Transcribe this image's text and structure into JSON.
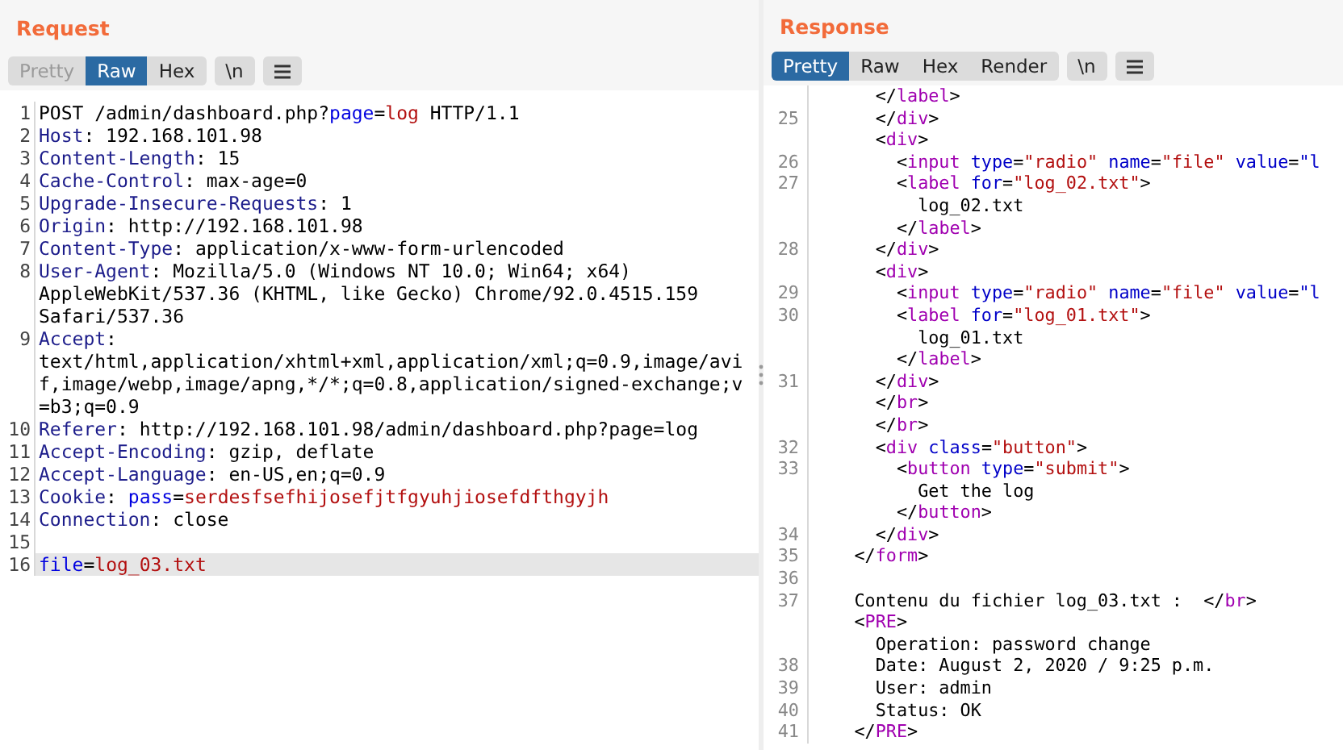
{
  "request": {
    "title": "Request",
    "tabs": [
      {
        "label": "Pretty",
        "selected": false,
        "disabled": true
      },
      {
        "label": "Raw",
        "selected": true,
        "disabled": false
      },
      {
        "label": "Hex",
        "selected": false,
        "disabled": false
      }
    ],
    "newline_button": "\\n",
    "lines": [
      {
        "number": "1",
        "highlighted": false,
        "rows": [
          [
            {
              "kind": "text",
              "text": "POST /admin/dashboard.php?"
            },
            {
              "kind": "param",
              "text": "page"
            },
            {
              "kind": "text",
              "text": "="
            },
            {
              "kind": "value",
              "text": "log"
            },
            {
              "kind": "text",
              "text": " HTTP/1.1"
            }
          ]
        ]
      },
      {
        "number": "2",
        "highlighted": false,
        "rows": [
          [
            {
              "kind": "key",
              "text": "Host"
            },
            {
              "kind": "text",
              "text": ": 192.168.101.98"
            }
          ]
        ]
      },
      {
        "number": "3",
        "highlighted": false,
        "rows": [
          [
            {
              "kind": "key",
              "text": "Content-Length"
            },
            {
              "kind": "text",
              "text": ": 15"
            }
          ]
        ]
      },
      {
        "number": "4",
        "highlighted": false,
        "rows": [
          [
            {
              "kind": "key",
              "text": "Cache-Control"
            },
            {
              "kind": "text",
              "text": ": max-age=0"
            }
          ]
        ]
      },
      {
        "number": "5",
        "highlighted": false,
        "rows": [
          [
            {
              "kind": "key",
              "text": "Upgrade-Insecure-Requests"
            },
            {
              "kind": "text",
              "text": ": 1"
            }
          ]
        ]
      },
      {
        "number": "6",
        "highlighted": false,
        "rows": [
          [
            {
              "kind": "key",
              "text": "Origin"
            },
            {
              "kind": "text",
              "text": ": http://192.168.101.98"
            }
          ]
        ]
      },
      {
        "number": "7",
        "highlighted": false,
        "rows": [
          [
            {
              "kind": "key",
              "text": "Content-Type"
            },
            {
              "kind": "text",
              "text": ": application/x-www-form-urlencoded"
            }
          ]
        ]
      },
      {
        "number": "8",
        "highlighted": false,
        "rows": [
          [
            {
              "kind": "key",
              "text": "User-Agent"
            },
            {
              "kind": "text",
              "text": ": Mozilla/5.0 (Windows NT 10.0; Win64; x64)"
            }
          ],
          [
            {
              "kind": "text",
              "text": "AppleWebKit/537.36 (KHTML, like Gecko) Chrome/92.0.4515.159"
            }
          ],
          [
            {
              "kind": "text",
              "text": "Safari/537.36"
            }
          ]
        ]
      },
      {
        "number": "9",
        "highlighted": false,
        "rows": [
          [
            {
              "kind": "key",
              "text": "Accept"
            },
            {
              "kind": "text",
              "text": ":"
            }
          ],
          [
            {
              "kind": "text",
              "text": "text/html,application/xhtml+xml,application/xml;q=0.9,image/avi"
            }
          ],
          [
            {
              "kind": "text",
              "text": "f,image/webp,image/apng,*/*;q=0.8,application/signed-exchange;v"
            }
          ],
          [
            {
              "kind": "text",
              "text": "=b3;q=0.9"
            }
          ]
        ]
      },
      {
        "number": "10",
        "highlighted": false,
        "rows": [
          [
            {
              "kind": "key",
              "text": "Referer"
            },
            {
              "kind": "text",
              "text": ": http://192.168.101.98/admin/dashboard.php?page=log"
            }
          ]
        ]
      },
      {
        "number": "11",
        "highlighted": false,
        "rows": [
          [
            {
              "kind": "key",
              "text": "Accept-Encoding"
            },
            {
              "kind": "text",
              "text": ": gzip, deflate"
            }
          ]
        ]
      },
      {
        "number": "12",
        "highlighted": false,
        "rows": [
          [
            {
              "kind": "key",
              "text": "Accept-Language"
            },
            {
              "kind": "text",
              "text": ": en-US,en;q=0.9"
            }
          ]
        ]
      },
      {
        "number": "13",
        "highlighted": false,
        "rows": [
          [
            {
              "kind": "key",
              "text": "Cookie"
            },
            {
              "kind": "text",
              "text": ": "
            },
            {
              "kind": "param",
              "text": "pass"
            },
            {
              "kind": "text",
              "text": "="
            },
            {
              "kind": "value",
              "text": "serdesfsefhijosefjtfgyuhjiosefdfthgyjh"
            }
          ]
        ]
      },
      {
        "number": "14",
        "highlighted": false,
        "rows": [
          [
            {
              "kind": "key",
              "text": "Connection"
            },
            {
              "kind": "text",
              "text": ": close"
            }
          ]
        ]
      },
      {
        "number": "15",
        "highlighted": false,
        "rows": [
          []
        ]
      },
      {
        "number": "16",
        "highlighted": true,
        "rows": [
          [
            {
              "kind": "param",
              "text": "file"
            },
            {
              "kind": "text",
              "text": "="
            },
            {
              "kind": "value",
              "text": "log_03.txt"
            }
          ]
        ]
      }
    ]
  },
  "response": {
    "title": "Response",
    "tabs": [
      {
        "label": "Pretty",
        "selected": true,
        "disabled": false
      },
      {
        "label": "Raw",
        "selected": false,
        "disabled": false
      },
      {
        "label": "Hex",
        "selected": false,
        "disabled": false
      },
      {
        "label": "Render",
        "selected": false,
        "disabled": false
      }
    ],
    "newline_button": "\\n",
    "lines": [
      {
        "rows": [
          [
            {
              "kind": "text",
              "text": "      </"
            },
            {
              "kind": "tag",
              "text": "label"
            },
            {
              "kind": "text",
              "text": ">"
            }
          ]
        ]
      },
      {
        "number": "25",
        "rows": [
          [
            {
              "kind": "text",
              "text": "      </"
            },
            {
              "kind": "tag",
              "text": "div"
            },
            {
              "kind": "text",
              "text": ">"
            }
          ]
        ]
      },
      {
        "rows": [
          [
            {
              "kind": "text",
              "text": "      <"
            },
            {
              "kind": "tag",
              "text": "div"
            },
            {
              "kind": "text",
              "text": ">"
            }
          ]
        ]
      },
      {
        "number": "26",
        "rows": [
          [
            {
              "kind": "text",
              "text": "        <"
            },
            {
              "kind": "tag",
              "text": "input"
            },
            {
              "kind": "text",
              "text": " "
            },
            {
              "kind": "attr",
              "text": "type"
            },
            {
              "kind": "text",
              "text": "="
            },
            {
              "kind": "value",
              "text": "\"radio\""
            },
            {
              "kind": "text",
              "text": " "
            },
            {
              "kind": "attr",
              "text": "name"
            },
            {
              "kind": "text",
              "text": "="
            },
            {
              "kind": "value",
              "text": "\"file\""
            },
            {
              "kind": "text",
              "text": " "
            },
            {
              "kind": "attr",
              "text": "value"
            },
            {
              "kind": "text",
              "text": "="
            },
            {
              "kind": "attr",
              "text": "\"l"
            }
          ]
        ]
      },
      {
        "number": "27",
        "rows": [
          [
            {
              "kind": "text",
              "text": "        <"
            },
            {
              "kind": "tag",
              "text": "label"
            },
            {
              "kind": "text",
              "text": " "
            },
            {
              "kind": "attr",
              "text": "for"
            },
            {
              "kind": "text",
              "text": "="
            },
            {
              "kind": "value",
              "text": "\"log_02.txt\""
            },
            {
              "kind": "text",
              "text": ">"
            }
          ]
        ]
      },
      {
        "rows": [
          [
            {
              "kind": "text",
              "text": "          log_02.txt"
            }
          ]
        ]
      },
      {
        "rows": [
          [
            {
              "kind": "text",
              "text": "        </"
            },
            {
              "kind": "tag",
              "text": "label"
            },
            {
              "kind": "text",
              "text": ">"
            }
          ]
        ]
      },
      {
        "number": "28",
        "rows": [
          [
            {
              "kind": "text",
              "text": "      </"
            },
            {
              "kind": "tag",
              "text": "div"
            },
            {
              "kind": "text",
              "text": ">"
            }
          ]
        ]
      },
      {
        "rows": [
          [
            {
              "kind": "text",
              "text": "      <"
            },
            {
              "kind": "tag",
              "text": "div"
            },
            {
              "kind": "text",
              "text": ">"
            }
          ]
        ]
      },
      {
        "number": "29",
        "rows": [
          [
            {
              "kind": "text",
              "text": "        <"
            },
            {
              "kind": "tag",
              "text": "input"
            },
            {
              "kind": "text",
              "text": " "
            },
            {
              "kind": "attr",
              "text": "type"
            },
            {
              "kind": "text",
              "text": "="
            },
            {
              "kind": "value",
              "text": "\"radio\""
            },
            {
              "kind": "text",
              "text": " "
            },
            {
              "kind": "attr",
              "text": "name"
            },
            {
              "kind": "text",
              "text": "="
            },
            {
              "kind": "value",
              "text": "\"file\""
            },
            {
              "kind": "text",
              "text": " "
            },
            {
              "kind": "attr",
              "text": "value"
            },
            {
              "kind": "text",
              "text": "="
            },
            {
              "kind": "attr",
              "text": "\"l"
            }
          ]
        ]
      },
      {
        "number": "30",
        "rows": [
          [
            {
              "kind": "text",
              "text": "        <"
            },
            {
              "kind": "tag",
              "text": "label"
            },
            {
              "kind": "text",
              "text": " "
            },
            {
              "kind": "attr",
              "text": "for"
            },
            {
              "kind": "text",
              "text": "="
            },
            {
              "kind": "value",
              "text": "\"log_01.txt\""
            },
            {
              "kind": "text",
              "text": ">"
            }
          ]
        ]
      },
      {
        "rows": [
          [
            {
              "kind": "text",
              "text": "          log_01.txt"
            }
          ]
        ]
      },
      {
        "rows": [
          [
            {
              "kind": "text",
              "text": "        </"
            },
            {
              "kind": "tag",
              "text": "label"
            },
            {
              "kind": "text",
              "text": ">"
            }
          ]
        ]
      },
      {
        "number": "31",
        "rows": [
          [
            {
              "kind": "text",
              "text": "      </"
            },
            {
              "kind": "tag",
              "text": "div"
            },
            {
              "kind": "text",
              "text": ">"
            }
          ]
        ]
      },
      {
        "rows": [
          [
            {
              "kind": "text",
              "text": "      </"
            },
            {
              "kind": "tag",
              "text": "br"
            },
            {
              "kind": "text",
              "text": ">"
            }
          ]
        ]
      },
      {
        "rows": [
          [
            {
              "kind": "text",
              "text": "      </"
            },
            {
              "kind": "tag",
              "text": "br"
            },
            {
              "kind": "text",
              "text": ">"
            }
          ]
        ]
      },
      {
        "number": "32",
        "rows": [
          [
            {
              "kind": "text",
              "text": "      <"
            },
            {
              "kind": "tag",
              "text": "div"
            },
            {
              "kind": "text",
              "text": " "
            },
            {
              "kind": "attr",
              "text": "class"
            },
            {
              "kind": "text",
              "text": "="
            },
            {
              "kind": "value",
              "text": "\"button\""
            },
            {
              "kind": "text",
              "text": ">"
            }
          ]
        ]
      },
      {
        "number": "33",
        "rows": [
          [
            {
              "kind": "text",
              "text": "        <"
            },
            {
              "kind": "tag",
              "text": "button"
            },
            {
              "kind": "text",
              "text": " "
            },
            {
              "kind": "attr",
              "text": "type"
            },
            {
              "kind": "text",
              "text": "="
            },
            {
              "kind": "value",
              "text": "\"submit\""
            },
            {
              "kind": "text",
              "text": ">"
            }
          ]
        ]
      },
      {
        "rows": [
          [
            {
              "kind": "text",
              "text": "          Get the log"
            }
          ]
        ]
      },
      {
        "rows": [
          [
            {
              "kind": "text",
              "text": "        </"
            },
            {
              "kind": "tag",
              "text": "button"
            },
            {
              "kind": "text",
              "text": ">"
            }
          ]
        ]
      },
      {
        "number": "34",
        "rows": [
          [
            {
              "kind": "text",
              "text": "      </"
            },
            {
              "kind": "tag",
              "text": "div"
            },
            {
              "kind": "text",
              "text": ">"
            }
          ]
        ]
      },
      {
        "number": "35",
        "rows": [
          [
            {
              "kind": "text",
              "text": "    </"
            },
            {
              "kind": "tag",
              "text": "form"
            },
            {
              "kind": "text",
              "text": ">"
            }
          ]
        ]
      },
      {
        "number": "36",
        "rows": [
          []
        ]
      },
      {
        "number": "37",
        "rows": [
          [
            {
              "kind": "text",
              "text": "    Contenu du fichier log_03.txt :  </"
            },
            {
              "kind": "tag",
              "text": "br"
            },
            {
              "kind": "text",
              "text": ">"
            }
          ]
        ]
      },
      {
        "rows": [
          [
            {
              "kind": "text",
              "text": "    <"
            },
            {
              "kind": "tag",
              "text": "PRE"
            },
            {
              "kind": "text",
              "text": ">"
            }
          ]
        ]
      },
      {
        "rows": [
          [
            {
              "kind": "text",
              "text": "      Operation: password change"
            }
          ]
        ]
      },
      {
        "number": "38",
        "rows": [
          [
            {
              "kind": "text",
              "text": "      Date: August 2, 2020 / 9:25 p.m."
            }
          ]
        ]
      },
      {
        "number": "39",
        "rows": [
          [
            {
              "kind": "text",
              "text": "      User: admin"
            }
          ]
        ]
      },
      {
        "number": "40",
        "rows": [
          [
            {
              "kind": "text",
              "text": "      Status: OK"
            }
          ]
        ]
      },
      {
        "number": "41",
        "rows": [
          [
            {
              "kind": "text",
              "text": "    </"
            },
            {
              "kind": "tag",
              "text": "PRE"
            },
            {
              "kind": "text",
              "text": ">"
            }
          ]
        ]
      }
    ]
  }
}
